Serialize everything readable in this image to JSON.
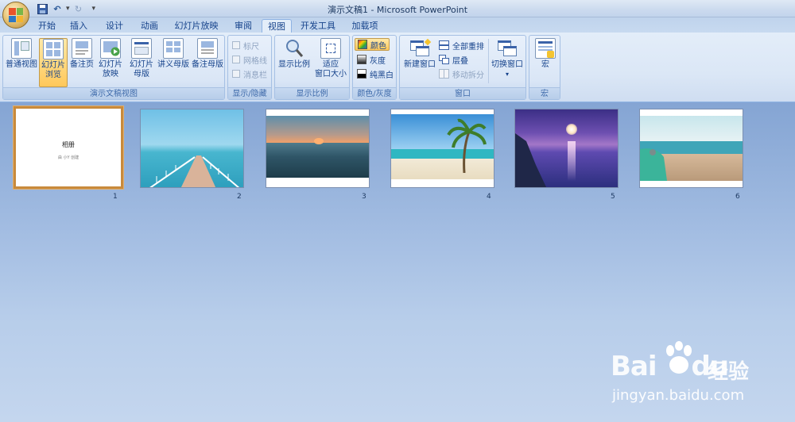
{
  "window": {
    "title": "演示文稿1 - Microsoft PowerPoint"
  },
  "qat": {
    "save": "💾",
    "undo": "↶",
    "undo_drop": "▾",
    "redo": "↻",
    "customize": "▾"
  },
  "tabs": [
    "开始",
    "插入",
    "设计",
    "动画",
    "幻灯片放映",
    "审阅",
    "视图",
    "开发工具",
    "加载项"
  ],
  "active_tab": "视图",
  "ribbon": {
    "presentation_views": {
      "label": "演示文稿视图",
      "buttons": [
        {
          "line1": "普通视图",
          "line2": ""
        },
        {
          "line1": "幻灯片",
          "line2": "浏览"
        },
        {
          "line1": "备注页",
          "line2": ""
        },
        {
          "line1": "幻灯片",
          "line2": "放映"
        },
        {
          "line1": "幻灯片",
          "line2": "母版"
        },
        {
          "line1": "讲义母版",
          "line2": ""
        },
        {
          "line1": "备注母版",
          "line2": ""
        }
      ]
    },
    "show_hide": {
      "label": "显示/隐藏",
      "items": [
        "标尺",
        "网格线",
        "消息栏"
      ]
    },
    "zoom": {
      "label": "显示比例",
      "zoom_btn": "显示比例",
      "fit_l1": "适应",
      "fit_l2": "窗口大小"
    },
    "color": {
      "label": "颜色/灰度",
      "items": [
        "颜色",
        "灰度",
        "纯黑白"
      ]
    },
    "window": {
      "label": "窗口",
      "new_window": "新建窗口",
      "arrange_all": "全部重排",
      "cascade": "层叠",
      "move_split": "移动拆分",
      "switch": "切换窗口",
      "switch_arrow": "▾"
    },
    "macros": {
      "label": "宏",
      "btn": "宏"
    }
  },
  "slides": [
    {
      "num": "1",
      "title": "相册",
      "subtitle": "由 小Y 创建"
    },
    {
      "num": "2"
    },
    {
      "num": "3"
    },
    {
      "num": "4"
    },
    {
      "num": "5"
    },
    {
      "num": "6"
    }
  ],
  "watermark": {
    "brand": "Bai",
    "brand2": "du",
    "cn": "经验",
    "url": "jingyan.baidu.com"
  }
}
